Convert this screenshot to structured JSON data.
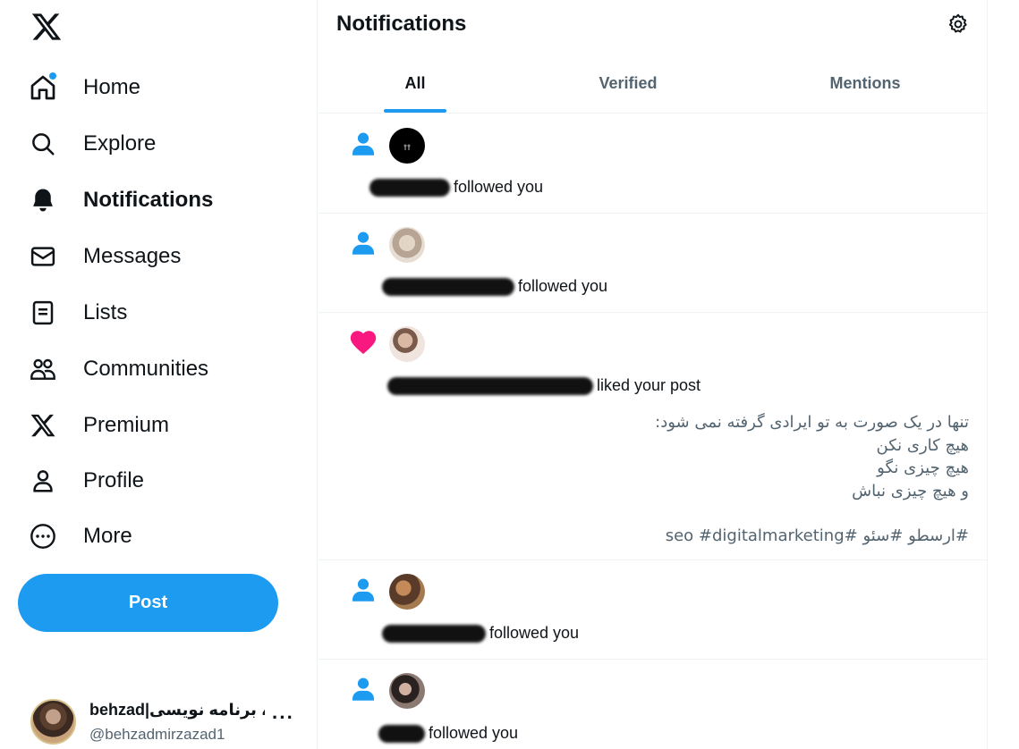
{
  "sidebar": {
    "items": [
      {
        "label": "Home",
        "icon": "home-icon"
      },
      {
        "label": "Explore",
        "icon": "search-icon"
      },
      {
        "label": "Notifications",
        "icon": "bell-icon",
        "active": true
      },
      {
        "label": "Messages",
        "icon": "envelope-icon"
      },
      {
        "label": "Lists",
        "icon": "list-icon"
      },
      {
        "label": "Communities",
        "icon": "communities-icon"
      },
      {
        "label": "Premium",
        "icon": "x-logo-icon"
      },
      {
        "label": "Profile",
        "icon": "person-icon"
      },
      {
        "label": "More",
        "icon": "more-circle-icon"
      }
    ],
    "post_label": "Post",
    "account": {
      "name": "behzad|ئو، برنامه نویسی",
      "handle": "@behzadmirzazad1",
      "more": "···"
    }
  },
  "header": {
    "title": "Notifications"
  },
  "tabs": [
    {
      "label": "All",
      "active": true
    },
    {
      "label": "Verified"
    },
    {
      "label": "Mentions"
    }
  ],
  "notifications": [
    {
      "type": "follow",
      "icon": "person-icon",
      "action": "followed you"
    },
    {
      "type": "follow",
      "icon": "person-icon",
      "action": "followed you"
    },
    {
      "type": "like",
      "icon": "heart-icon",
      "action": "liked your post",
      "post_lines": [
        "تنها در یک صورت به تو ایرادی گرفته نمی شود:",
        "هیچ کاری نکن",
        "هیچ چیزی نگو",
        "و هیچ چیزی نباش",
        "",
        "#ارسطو #سئو #seo #digitalmarketing"
      ]
    },
    {
      "type": "follow",
      "icon": "person-icon",
      "action": "followed you"
    },
    {
      "type": "follow",
      "icon": "person-icon",
      "action": "followed you"
    }
  ],
  "colors": {
    "accent": "#1d9bf0",
    "like": "#f91880",
    "text": "#0f1419",
    "secondary": "#536471",
    "border": "#eff3f4"
  }
}
